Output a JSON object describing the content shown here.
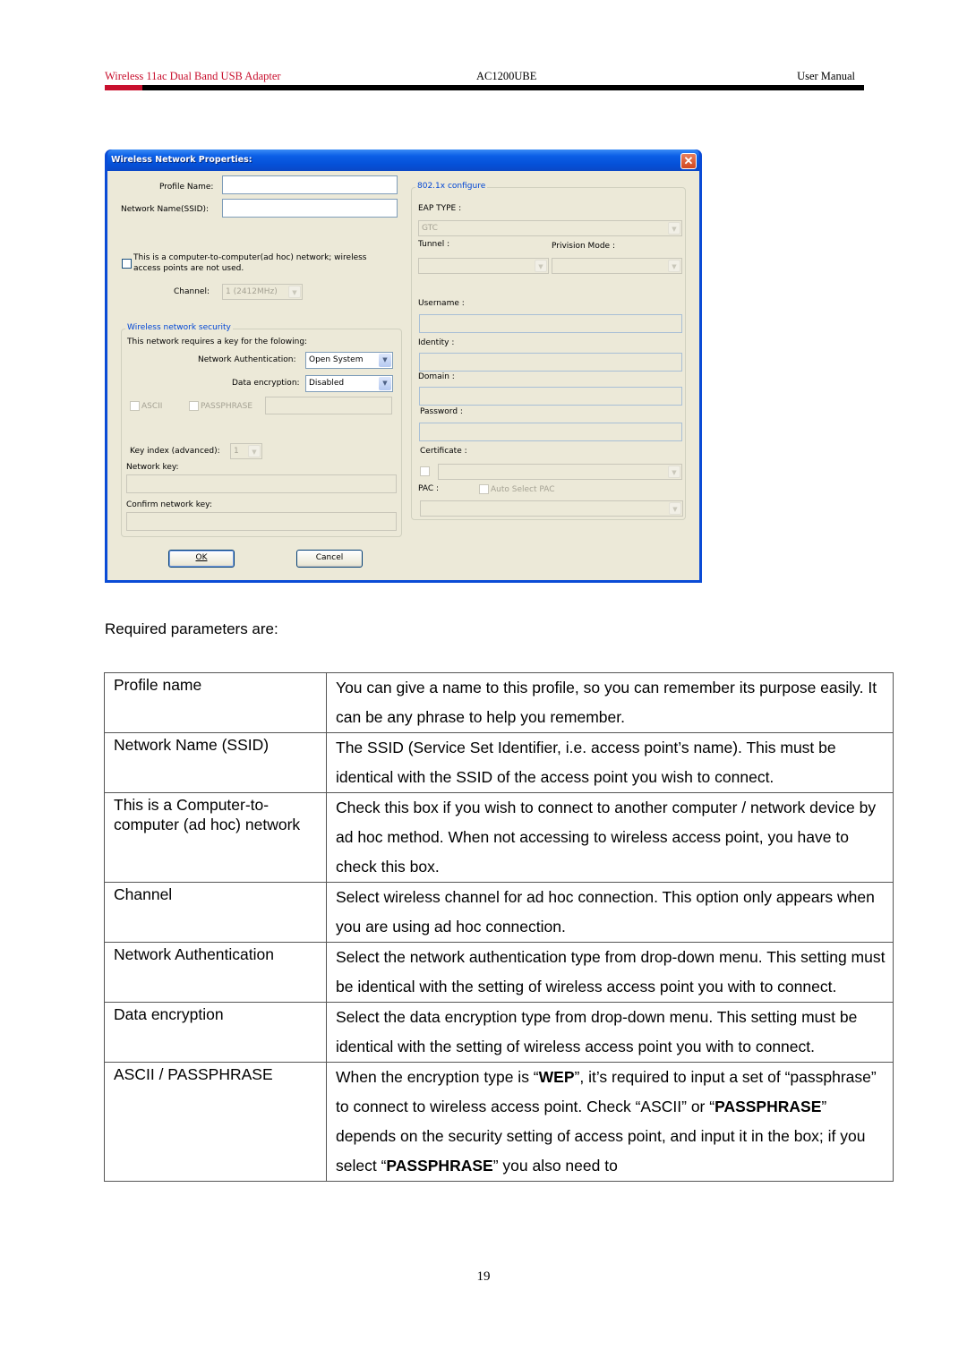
{
  "header": {
    "left": "Wireless 11ac Dual Band USB Adapter",
    "center": "AC1200UBE",
    "right": "User Manual",
    "accent_color": "#c8102e"
  },
  "dialog": {
    "title": "Wireless Network Properties:",
    "close_icon": "close-icon",
    "profile_name_label": "Profile Name:",
    "profile_name_value": "",
    "ssid_label": "Network Name(SSID):",
    "ssid_value": "",
    "adhoc_label_line1": "This is a computer-to-computer(ad hoc) network; wireless",
    "adhoc_label_line2": "access points are not used.",
    "adhoc_checked": false,
    "channel_label": "Channel:",
    "channel_value": "1  (2412MHz)",
    "security": {
      "group_title": "Wireless network security",
      "intro": "This network requires a key for the folowing:",
      "auth_label": "Network Authentication:",
      "auth_value": "Open System",
      "enc_label": "Data encryption:",
      "enc_value": "Disabled",
      "ascii_label": "ASCII",
      "passphrase_label": "PASSPHRASE",
      "key_index_label": "Key index (advanced):",
      "key_index_value": "1",
      "network_key_label": "Network key:",
      "confirm_key_label": "Confirm network key:"
    },
    "dot1x": {
      "group_title": "802.1x configure",
      "eap_type_label": "EAP TYPE :",
      "eap_type_value": "GTC",
      "tunnel_label": "Tunnel :",
      "tunnel_value": "",
      "provision_label": "Privision Mode :",
      "provision_value": "",
      "username_label": "Username :",
      "identity_label": "Identity :",
      "domain_label": "Domain :",
      "password_label": "Password :",
      "certificate_label": "Certificate :",
      "pac_label": "PAC :",
      "auto_pac_label": "Auto Select PAC"
    },
    "ok_label": "OK",
    "cancel_label": "Cancel"
  },
  "body": {
    "intro": "Required parameters are:",
    "table": [
      {
        "key": "Profile name",
        "value": "You can give a name to this profile, so you can remember its purpose easily. It can be any phrase to help you remember."
      },
      {
        "key": "Network Name (SSID)",
        "value": "The SSID (Service Set Identifier, i.e. access point’s name). This must be identical with the SSID of the access point you wish to connect."
      },
      {
        "key": "This is a Computer-to-computer (ad hoc) network",
        "value": "Check this box if you wish to connect to another computer / network device by ad hoc method. When not accessing to wireless access point, you have to check this box."
      },
      {
        "key": "Channel",
        "value": "Select wireless channel for ad hoc connection. This option only appears when you are using ad hoc connection."
      },
      {
        "key": "Network Authentication",
        "value": "Select the network authentication type from drop-down menu. This setting must be identical with the setting of wireless access point you with to connect."
      },
      {
        "key": "Data encryption",
        "value": "Select the data encryption type from drop-down menu. This setting must be identical with the setting of wireless access point you with to connect."
      },
      {
        "key": "ASCII / PASSPHRASE",
        "value_parts": [
          "When the encryption type is “",
          "WEP",
          "”, it’s required to input a set of “passphrase” to connect to wireless access point. Check “ASCII” or “",
          "PASSPHRASE",
          "” depends on the security setting of access point, and input it in the box; if you select “",
          "PASSPHRASE",
          "” you also need to"
        ]
      }
    ]
  },
  "footer": {
    "page_number": "19"
  }
}
